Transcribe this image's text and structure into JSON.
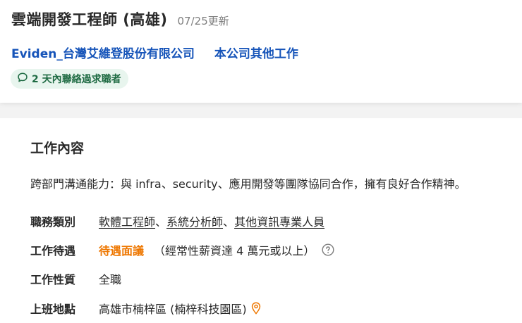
{
  "header": {
    "job_title": "雲端開發工程師 (高雄)",
    "updated": "07/25更新",
    "company_name": "Eviden_台灣艾維登股份有限公司",
    "other_jobs_label": "本公司其他工作",
    "contact_badge": "2 天內聯絡過求職者"
  },
  "content": {
    "section_title": "工作內容",
    "description": "跨部門溝通能力：與 infra、security、應用開發等團隊協同合作，擁有良好合作精神。",
    "category": {
      "label": "職務類別",
      "items": [
        "軟體工程師",
        "系統分析師",
        "其他資訊專業人員"
      ],
      "separator": "、"
    },
    "salary": {
      "label": "工作待遇",
      "value": "待遇面議",
      "note": "（經常性薪資達 4 萬元或以上）"
    },
    "job_type": {
      "label": "工作性質",
      "value": "全職"
    },
    "location": {
      "label": "上班地點",
      "value": "高雄市楠梓區 (楠梓科技園區)"
    }
  },
  "colors": {
    "link_blue": "#1654b9",
    "salary_orange": "#ee7700",
    "badge_green_bg": "#e8f5ee",
    "badge_green_text": "#1f6b43"
  },
  "icons": [
    "chat-bubble-icon",
    "question-circle-icon",
    "map-pin-icon"
  ]
}
